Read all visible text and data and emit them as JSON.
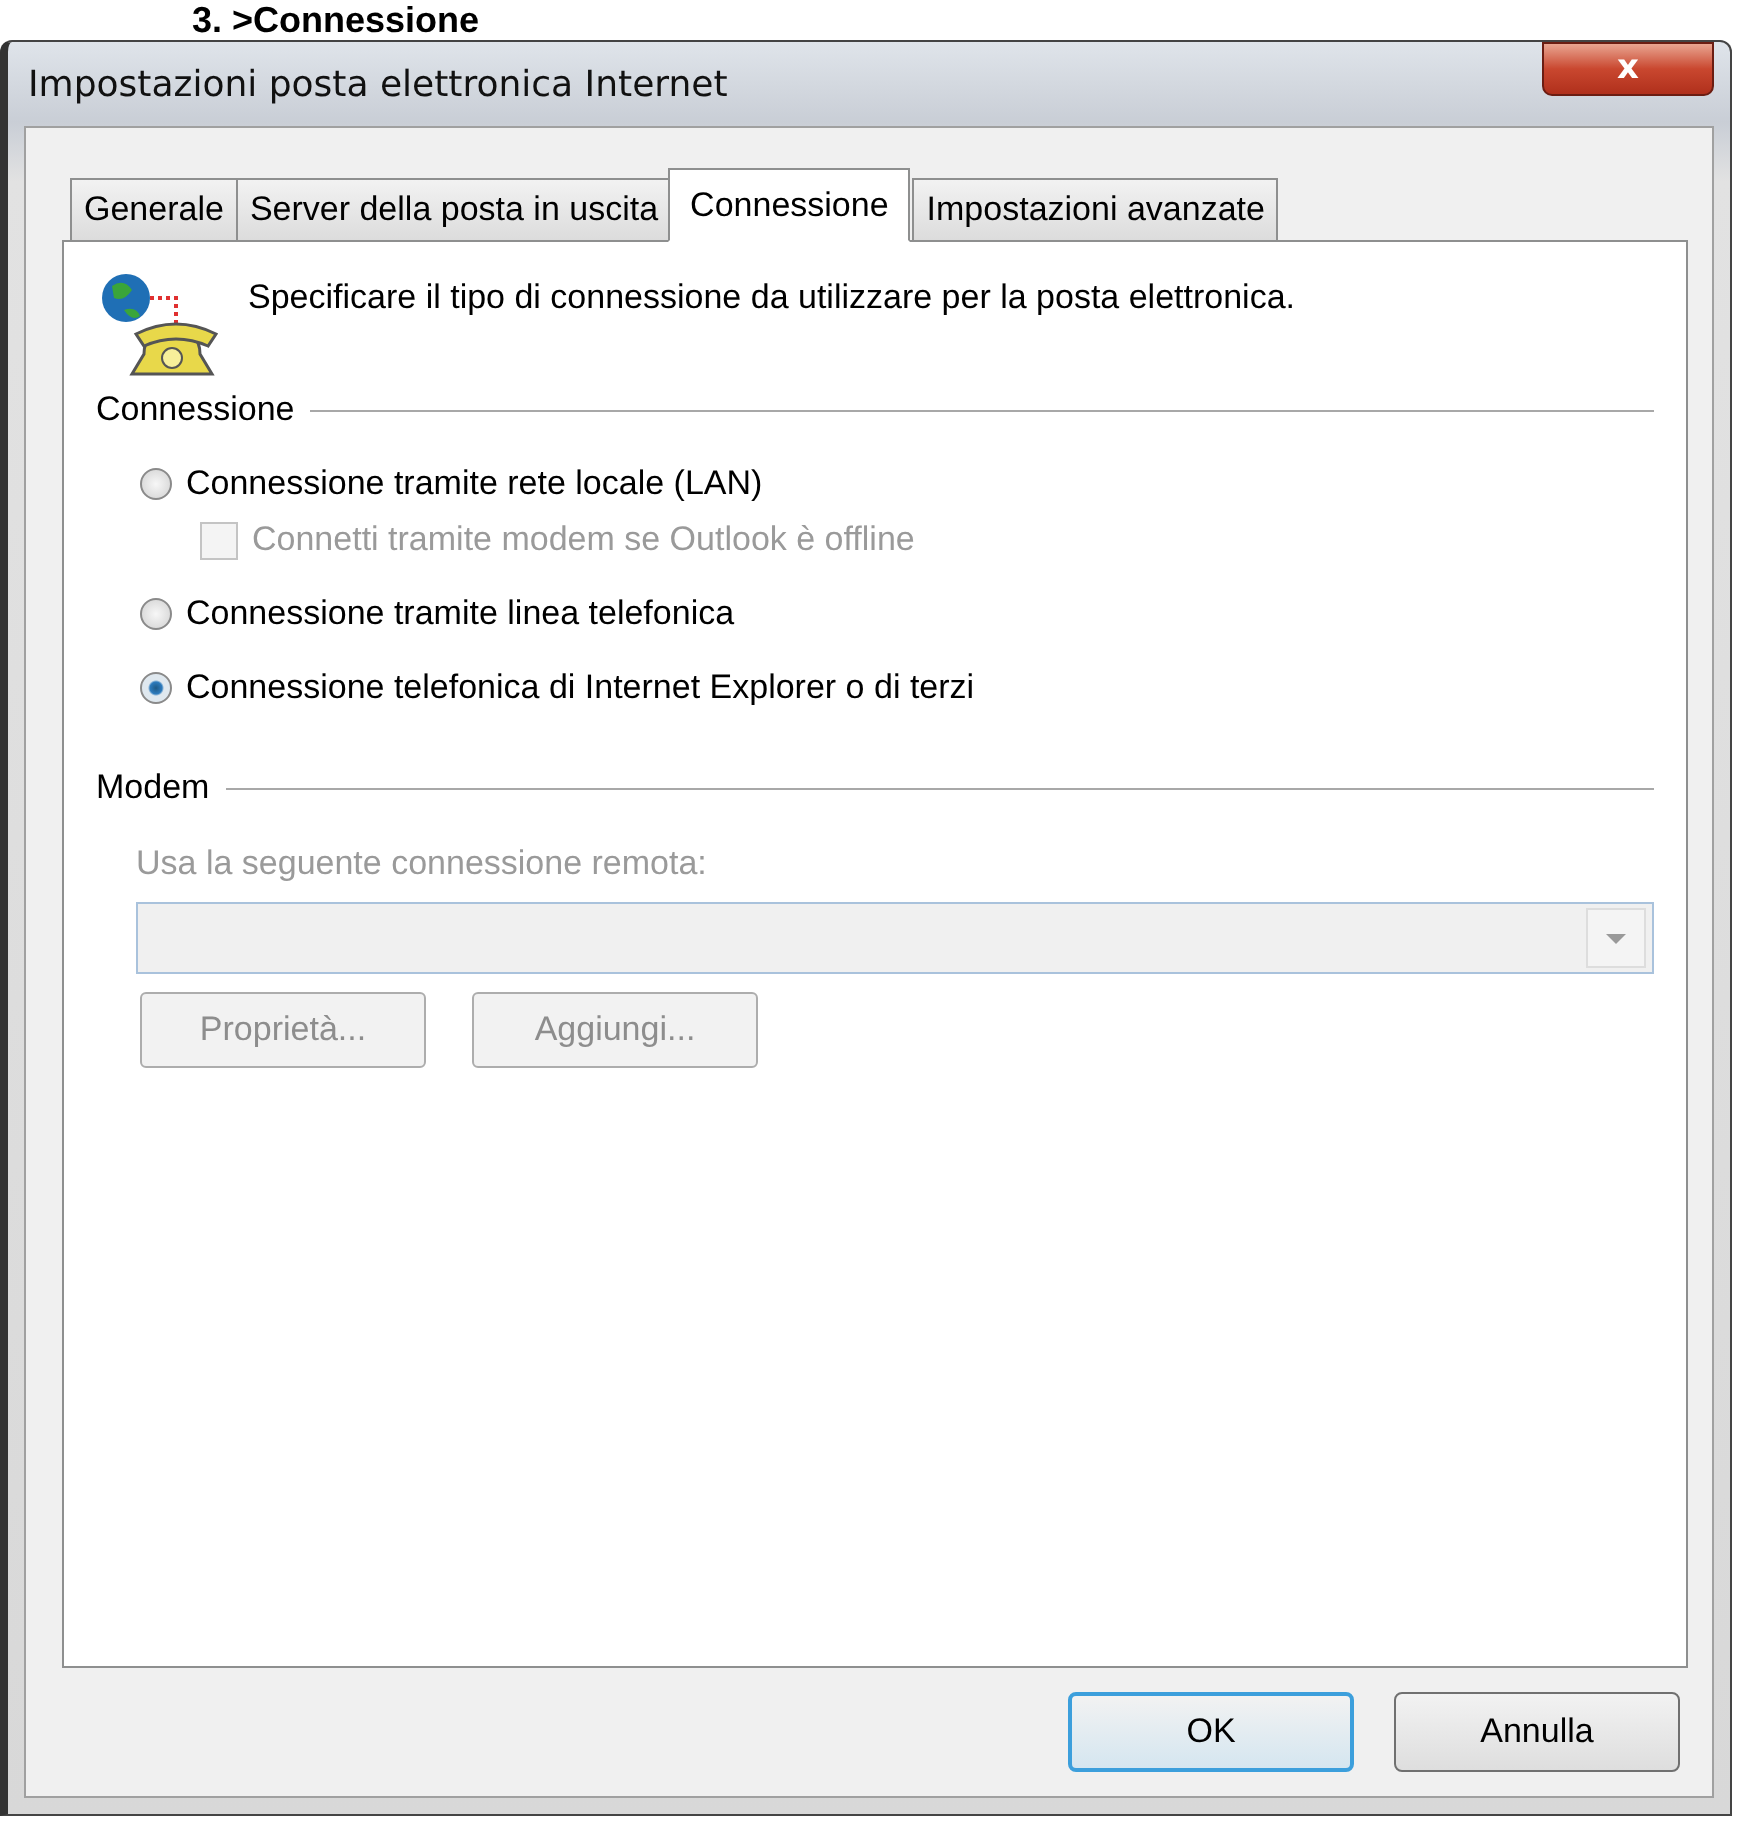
{
  "heading": "3. >Connessione",
  "window": {
    "title": "Impostazioni posta elettronica Internet",
    "close": "x"
  },
  "tabs": [
    {
      "label": "Generale",
      "selected": false
    },
    {
      "label": "Server della posta in uscita",
      "selected": false
    },
    {
      "label": "Connessione",
      "selected": true
    },
    {
      "label": "Impostazioni avanzate",
      "selected": false
    }
  ],
  "description": "Specificare il tipo di connessione da utilizzare per la posta elettronica.",
  "connection_group": {
    "label": "Connessione",
    "options": [
      {
        "kind": "radio",
        "label": "Connessione tramite rete locale (LAN)",
        "selected": false,
        "children": [
          {
            "kind": "checkbox",
            "label": "Connetti tramite modem se Outlook è offline",
            "checked": false,
            "disabled": true
          }
        ]
      },
      {
        "kind": "radio",
        "label": "Connessione tramite linea telefonica",
        "selected": false
      },
      {
        "kind": "radio",
        "label": "Connessione telefonica di Internet Explorer o di terzi",
        "selected": true
      }
    ]
  },
  "modem_group": {
    "label": "Modem",
    "field_label": "Usa la seguente connessione remota:",
    "disabled": true,
    "buttons": [
      "Proprietà...",
      "Aggiungi..."
    ]
  },
  "buttons": [
    {
      "label": "OK",
      "default": true
    },
    {
      "label": "Annulla",
      "default": false
    }
  ]
}
